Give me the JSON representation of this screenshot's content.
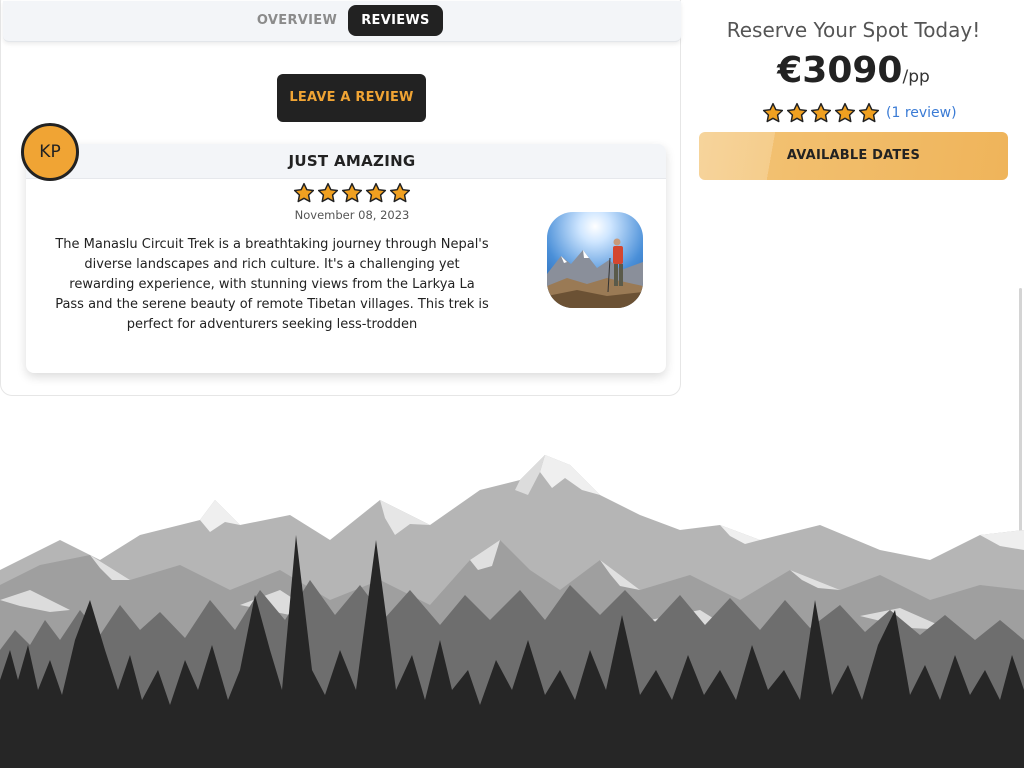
{
  "tabs": [
    {
      "label": "OVERVIEW",
      "active": false
    },
    {
      "label": "REVIEWS",
      "active": true
    }
  ],
  "leave_review_label": "LEAVE A REVIEW",
  "review": {
    "avatar_initials": "KP",
    "title": "JUST AMAZING",
    "rating": 5,
    "date": "November 08, 2023",
    "text": "The Manaslu Circuit Trek is a breathtaking journey through Nepal's diverse landscapes and rich culture. It's a challenging yet rewarding experience, with stunning views from the Larkya La Pass and the serene beauty of remote Tibetan villages. This trek is perfect for adventurers seeking less-trodden"
  },
  "booking": {
    "heading": "Reserve Your Spot Today!",
    "price": "€3090",
    "price_unit": "/pp",
    "rating": 5,
    "review_count_label": "(1 review)",
    "available_dates_label": "AVAILABLE DATES"
  },
  "colors": {
    "accent": "#f0a434",
    "dark": "#222222",
    "link": "#3a7bd5"
  }
}
